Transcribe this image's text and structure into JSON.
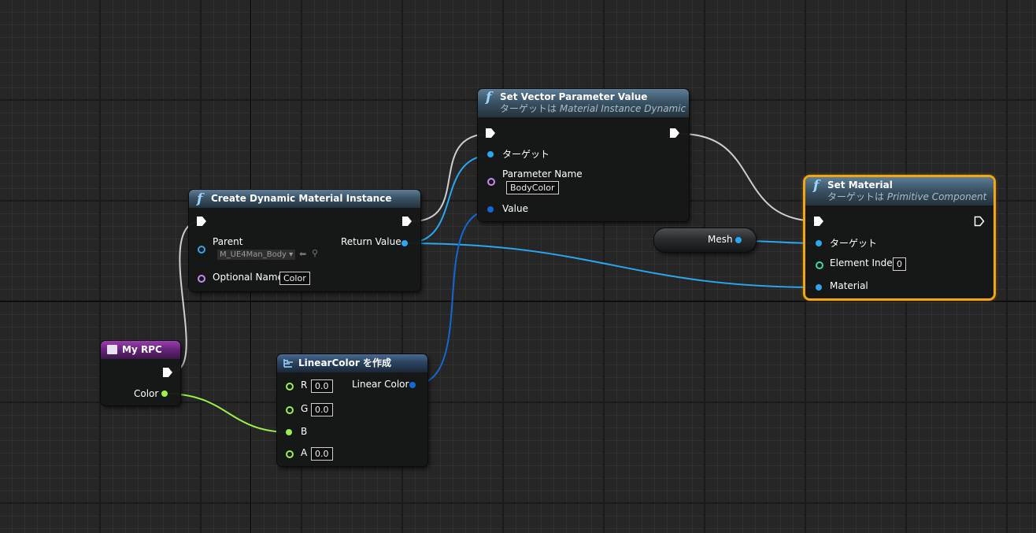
{
  "colors": {
    "exec_wire": "#cfcfcf",
    "object_pin": "#2aa7f0",
    "string_pin": "#c58cf0",
    "int_pin": "#35d8b0",
    "struct_pin": "#1467d6",
    "float_pin": "#9cf046",
    "selected_outline": "#f2a60f"
  },
  "nodes": {
    "create_dmi": {
      "title": "Create Dynamic Material Instance",
      "icon": "function-icon",
      "pins": {
        "parent_label": "Parent",
        "parent_asset": "M_UE4Man_Body",
        "optional_name_label": "Optional Name",
        "optional_name_value": "Color",
        "return_value_label": "Return Value"
      }
    },
    "set_vector_param": {
      "title": "Set Vector Parameter Value",
      "subtitle_prefix": "ターゲットは ",
      "subtitle_class": "Material Instance Dynamic",
      "icon": "function-icon",
      "pins": {
        "target_label": "ターゲット",
        "parameter_name_label": "Parameter Name",
        "parameter_name_value": "BodyColor",
        "value_label": "Value"
      }
    },
    "set_material": {
      "title": "Set Material",
      "subtitle_prefix": "ターゲットは ",
      "subtitle_class": "Primitive Component",
      "icon": "function-icon",
      "pins": {
        "target_label": "ターゲット",
        "element_index_label": "Element Index",
        "element_index_value": "0",
        "material_label": "Material"
      }
    },
    "mesh_var": {
      "label": "Mesh"
    },
    "my_rpc": {
      "title": "My RPC",
      "icon": "event-icon",
      "pins": {
        "color_label": "Color"
      }
    },
    "make_linear_color": {
      "title": "LinearColor を作成",
      "icon": "make-struct-icon",
      "pins": {
        "r_label": "R",
        "r_value": "0.0",
        "g_label": "G",
        "g_value": "0.0",
        "b_label": "B",
        "a_label": "A",
        "a_value": "0.0",
        "out_label": "Linear Color"
      }
    }
  }
}
